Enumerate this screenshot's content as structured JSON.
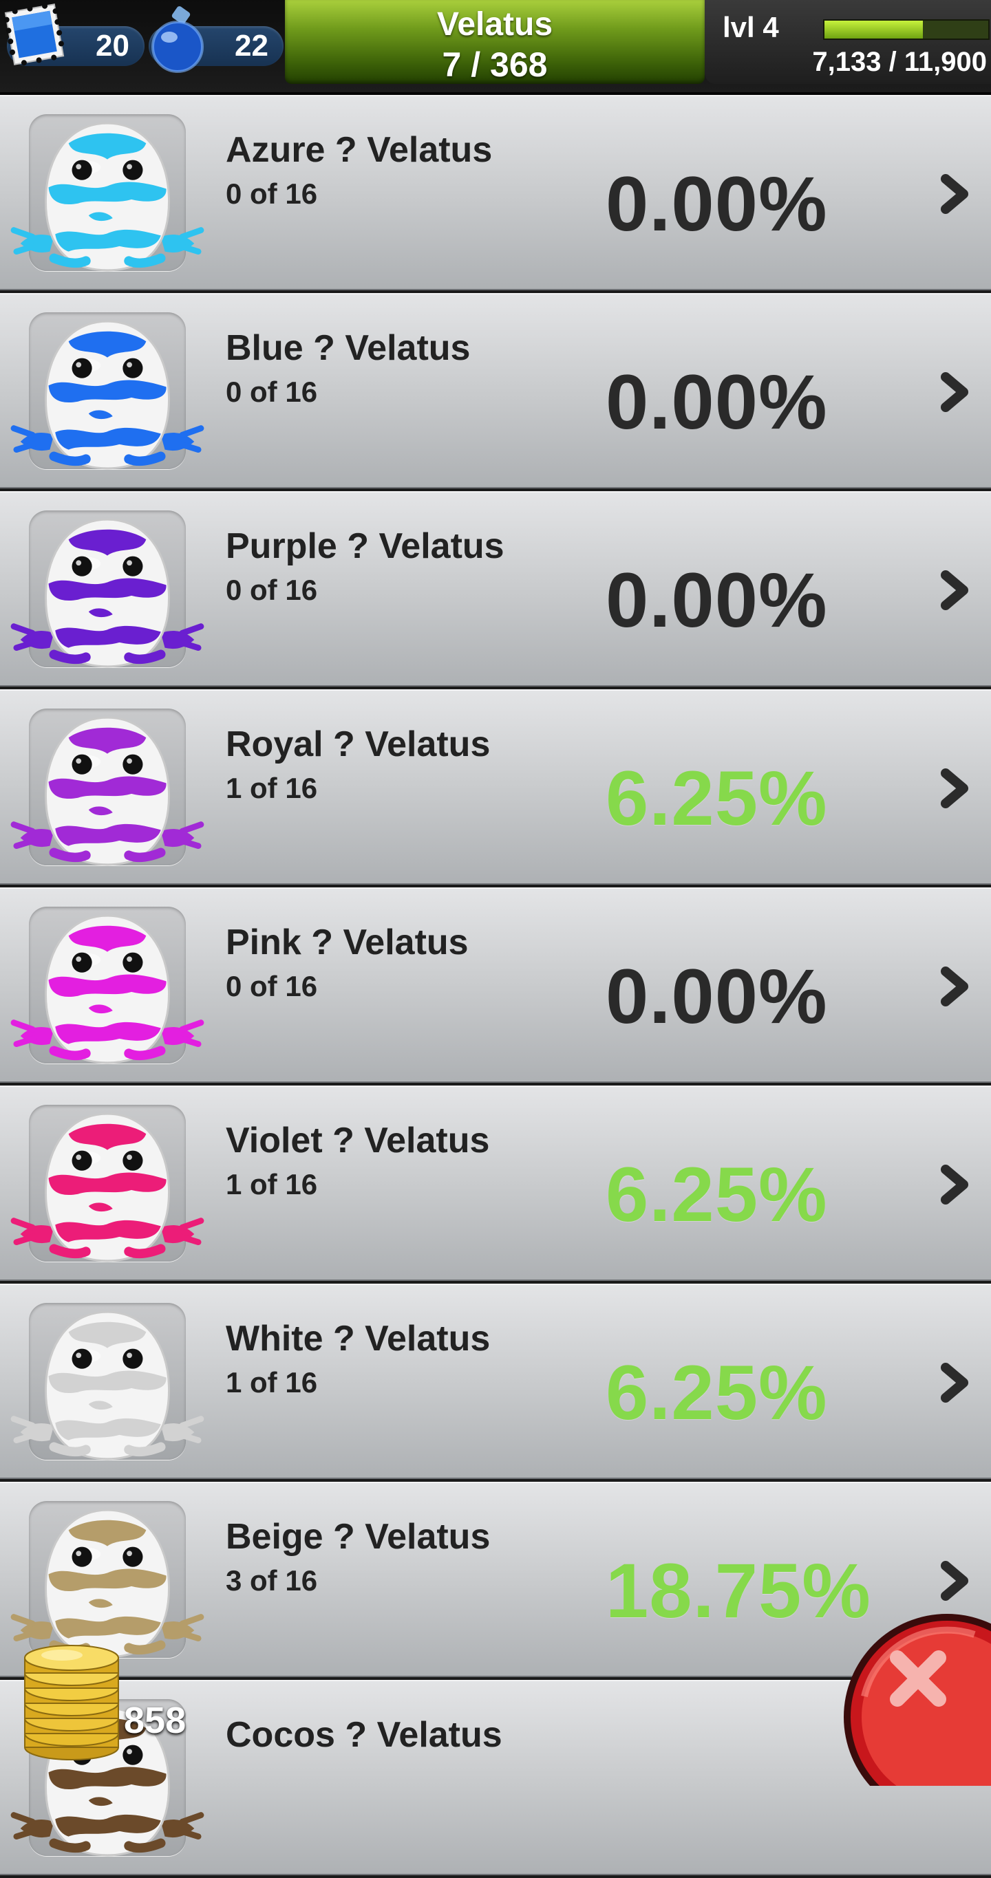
{
  "header": {
    "stamps": "20",
    "potions": "22",
    "title": "Velatus",
    "collected": "7 / 368",
    "level": "lvl 4",
    "xp": "7,133 / 11,900",
    "xp_fraction": 0.6
  },
  "rows": [
    {
      "name": "Azure ? Velatus",
      "count": "0 of 16",
      "percent": "0.00%",
      "color": "#2ec3f0",
      "highlight": false
    },
    {
      "name": "Blue ? Velatus",
      "count": "0 of 16",
      "percent": "0.00%",
      "color": "#1f6ff0",
      "highlight": false
    },
    {
      "name": "Purple ? Velatus",
      "count": "0 of 16",
      "percent": "0.00%",
      "color": "#6a1fd0",
      "highlight": false
    },
    {
      "name": "Royal ? Velatus",
      "count": "1 of 16",
      "percent": "6.25%",
      "color": "#a12ad6",
      "highlight": true
    },
    {
      "name": "Pink ? Velatus",
      "count": "0 of 16",
      "percent": "0.00%",
      "color": "#e31fe0",
      "highlight": false
    },
    {
      "name": "Violet ? Velatus",
      "count": "1 of 16",
      "percent": "6.25%",
      "color": "#ec1d78",
      "highlight": true
    },
    {
      "name": "White ? Velatus",
      "count": "1 of 16",
      "percent": "6.25%",
      "color": "#d2d2d2",
      "highlight": true
    },
    {
      "name": "Beige ? Velatus",
      "count": "3 of 16",
      "percent": "18.75%",
      "color": "#b59d6a",
      "highlight": true
    },
    {
      "name": "Cocos ? Velatus",
      "count": "",
      "percent": "",
      "color": "#6b4a2a",
      "highlight": true
    }
  ],
  "footer": {
    "coins": "858"
  },
  "icons": {
    "stamp": "stamp-icon",
    "potion": "potion-icon",
    "chevron": "chevron-right-icon",
    "coins": "coin-stack-icon",
    "close": "close-icon"
  }
}
